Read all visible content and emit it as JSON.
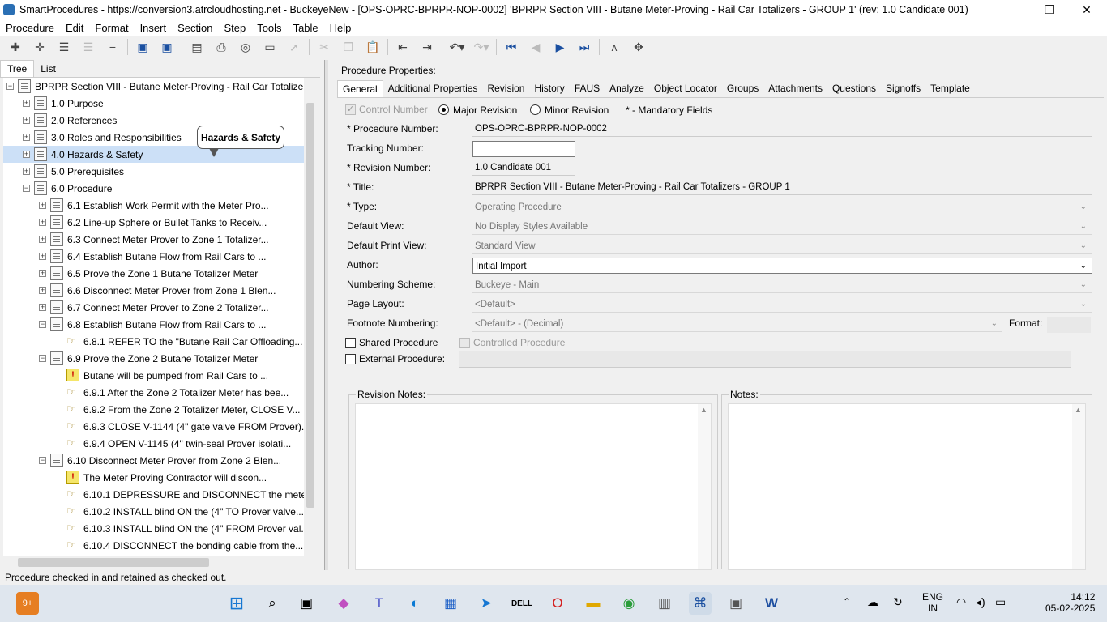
{
  "window": {
    "title": "SmartProcedures - https://conversion3.atrcloudhosting.net - BuckeyeNew - [OPS-OPRC-BPRPR-NOP-0002] 'BPRPR Section VIII - Butane Meter-Proving - Rail Car Totalizers - GROUP 1' (rev: 1.0 Candidate 001)"
  },
  "menu": [
    "Procedure",
    "Edit",
    "Format",
    "Insert",
    "Section",
    "Step",
    "Tools",
    "Table",
    "Help"
  ],
  "left_tabs": [
    "Tree",
    "List"
  ],
  "tree": [
    {
      "label": "BPRPR Section VIII - Butane Meter-Proving - Rail Car Totalizer...",
      "expander": "−",
      "icon": "doc"
    },
    {
      "label": "1.0 Purpose",
      "expander": "+",
      "icon": "doc"
    },
    {
      "label": "2.0 References",
      "expander": "+",
      "icon": "doc"
    },
    {
      "label": "3.0 Roles and Responsibilities",
      "expander": "+",
      "icon": "doc"
    },
    {
      "label": "4.0 Hazards & Safety",
      "expander": "+",
      "icon": "doc"
    },
    {
      "label": "5.0 Prerequisites",
      "expander": "+",
      "icon": "doc"
    },
    {
      "label": "6.0 Procedure",
      "expander": "−",
      "icon": "doc"
    },
    {
      "label": "6.1 Establish Work Permit with the Meter Pro...",
      "expander": "+",
      "icon": "doc"
    },
    {
      "label": "6.2 Line-up Sphere or Bullet Tanks to Receiv...",
      "expander": "+",
      "icon": "doc"
    },
    {
      "label": "6.3 Connect Meter Prover to Zone 1 Totalizer...",
      "expander": "+",
      "icon": "doc"
    },
    {
      "label": "6.4 Establish Butane Flow from Rail Cars to ...",
      "expander": "+",
      "icon": "doc"
    },
    {
      "label": "6.5 Prove the Zone 1 Butane Totalizer Meter",
      "expander": "+",
      "icon": "doc"
    },
    {
      "label": "6.6 Disconnect Meter Prover from Zone 1 Blen...",
      "expander": "+",
      "icon": "doc"
    },
    {
      "label": "6.7 Connect Meter Prover to Zone 2 Totalizer...",
      "expander": "+",
      "icon": "doc"
    },
    {
      "label": "6.8 Establish Butane Flow from Rail Cars to ...",
      "expander": "−",
      "icon": "doc"
    },
    {
      "label": "6.8.1 REFER TO the \"Butane Rail Car Offloading...",
      "expander": "",
      "icon": "step"
    },
    {
      "label": "6.9 Prove the Zone 2 Butane Totalizer Meter",
      "expander": "−",
      "icon": "doc"
    },
    {
      "label": "Butane will be pumped from Rail Cars to ...",
      "expander": "",
      "icon": "warn"
    },
    {
      "label": "6.9.1 After the Zone 2 Totalizer Meter has bee...",
      "expander": "",
      "icon": "step"
    },
    {
      "label": "6.9.2 From the Zone 2 Totalizer Meter, CLOSE V...",
      "expander": "",
      "icon": "step"
    },
    {
      "label": "6.9.3 CLOSE V-1144 (4\" gate valve FROM Prover)...",
      "expander": "",
      "icon": "step"
    },
    {
      "label": "6.9.4 OPEN V-1145 (4\" twin-seal Prover isolati...",
      "expander": "",
      "icon": "step"
    },
    {
      "label": "6.10 Disconnect Meter Prover from Zone 2 Blen...",
      "expander": "−",
      "icon": "doc"
    },
    {
      "label": "The Meter Proving Contractor will discon...",
      "expander": "",
      "icon": "warn"
    },
    {
      "label": "6.10.1 DEPRESSURE and DISCONNECT the meter-...",
      "expander": "",
      "icon": "step"
    },
    {
      "label": "6.10.2 INSTALL blind ON the (4\" TO Prover valve...",
      "expander": "",
      "icon": "step"
    },
    {
      "label": "6.10.3 INSTALL blind ON the (4\" FROM Prover val...",
      "expander": "",
      "icon": "step"
    },
    {
      "label": "6.10.4 DISCONNECT the bonding cable from the...",
      "expander": "",
      "icon": "step"
    }
  ],
  "callout": "Hazards & Safety",
  "props": {
    "header": "Procedure Properties:",
    "tabs": [
      "General",
      "Additional Properties",
      "Revision",
      "History",
      "FAUS",
      "Analyze",
      "Object Locator",
      "Groups",
      "Attachments",
      "Questions",
      "Signoffs",
      "Template"
    ],
    "control_number_label": "Control Number",
    "major_revision_label": "Major Revision",
    "minor_revision_label": "Minor Revision",
    "mandatory_note": "* - Mandatory Fields",
    "fields": {
      "procedure_number": {
        "label": "* Procedure Number:",
        "value": "OPS-OPRC-BPRPR-NOP-0002"
      },
      "tracking_number": {
        "label": "Tracking Number:",
        "value": ""
      },
      "revision_number": {
        "label": "* Revision Number:",
        "value": "1.0 Candidate 001"
      },
      "title": {
        "label": "* Title:",
        "value": "BPRPR Section VIII - Butane Meter-Proving - Rail Car Totalizers - GROUP 1"
      },
      "type": {
        "label": "* Type:",
        "value": "Operating Procedure"
      },
      "default_view": {
        "label": "Default View:",
        "value": "No Display Styles Available"
      },
      "default_print_view": {
        "label": "Default Print View:",
        "value": "Standard View"
      },
      "author": {
        "label": "Author:",
        "value": "Initial Import"
      },
      "numbering_scheme": {
        "label": "Numbering Scheme:",
        "value": "Buckeye - Main"
      },
      "page_layout": {
        "label": "Page Layout:",
        "value": "<Default>"
      },
      "footnote_numbering": {
        "label": "Footnote Numbering:",
        "value": "<Default> - (Decimal)"
      },
      "format": {
        "label": "Format:",
        "value": ""
      }
    },
    "shared_procedure_label": "Shared Procedure",
    "controlled_procedure_label": "Controlled Procedure",
    "external_procedure_label": "External Procedure:",
    "revision_notes_label": "Revision Notes:",
    "notes_label": "Notes:"
  },
  "status": "Procedure checked in and retained as checked out.",
  "taskbar": {
    "badge": "9+",
    "lang": "ENG",
    "region": "IN",
    "time": "14:12",
    "date": "05-02-2025"
  }
}
